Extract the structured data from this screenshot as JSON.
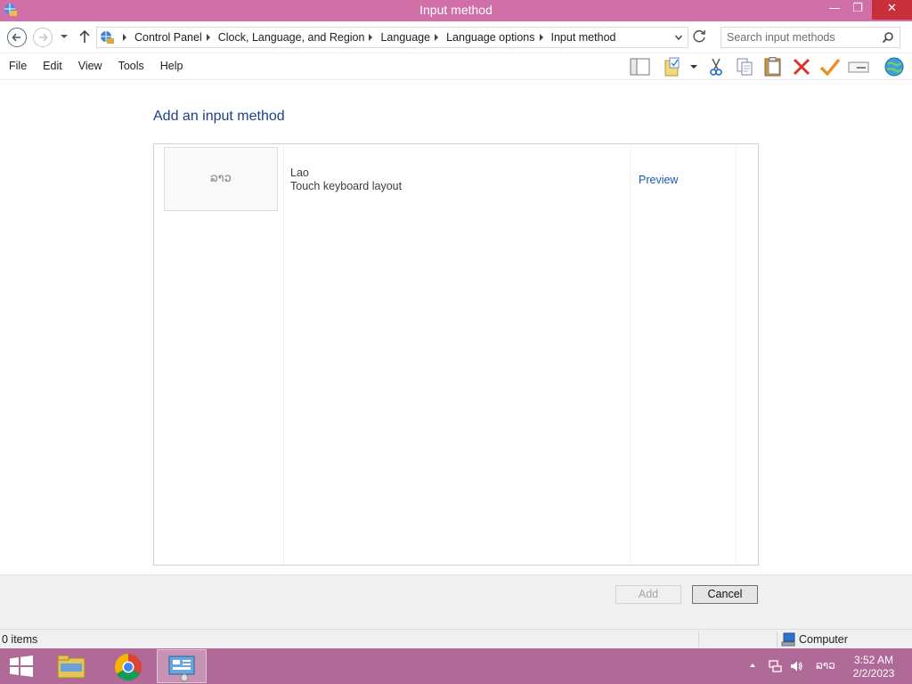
{
  "window": {
    "title": "Input method",
    "min_glyph": "—",
    "max_glyph": "❐",
    "close_glyph": "✕"
  },
  "address": {
    "crumbs": [
      "Control Panel",
      "Clock, Language, and Region",
      "Language",
      "Language options",
      "Input method"
    ]
  },
  "search": {
    "placeholder": "Search input methods"
  },
  "menu": {
    "items": [
      "File",
      "Edit",
      "View",
      "Tools",
      "Help"
    ]
  },
  "toolbar": {
    "icons": [
      "layout-pane-icon",
      "properties-icon",
      "cut-icon",
      "copy-icon",
      "paste-icon",
      "delete-icon",
      "checkmark-icon",
      "rename-icon",
      "globe-icon"
    ]
  },
  "content": {
    "heading": "Add an input method",
    "item": {
      "thumb_text": "ລາວ",
      "name": "Lao",
      "description": "Touch keyboard layout",
      "preview_label": "Preview"
    }
  },
  "buttons": {
    "add_label": "Add",
    "cancel_label": "Cancel"
  },
  "status": {
    "items_count": "0 items",
    "location": "Computer"
  },
  "taskbar": {
    "lang": "ລາວ",
    "time": "3:52 AM",
    "date": "2/2/2023"
  },
  "colors": {
    "titlebar": "#d16fa8",
    "taskbar": "#b06a98",
    "heading": "#1e3f8a",
    "link": "#1a5bb0",
    "close": "#c7303a"
  }
}
